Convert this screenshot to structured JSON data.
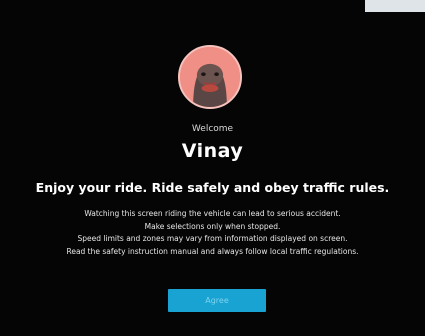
{
  "welcome_label": "Welcome",
  "user_name": "Vinay",
  "headline": "Enjoy your ride. Ride safely and obey traffic rules.",
  "notices": [
    "Watching this screen riding the vehicle can lead to serious accident.",
    "Make selections only when stopped.",
    "Speed limits and zones may vary from information displayed on screen.",
    "Read the safety instruction manual and always follow local traffic regulations."
  ],
  "agree_label": "Agree",
  "colors": {
    "background": "#050506",
    "accent_button": "#18a3d3",
    "avatar_bg": "#f08f86"
  },
  "icons": {
    "avatar": "user-avatar-icon"
  }
}
